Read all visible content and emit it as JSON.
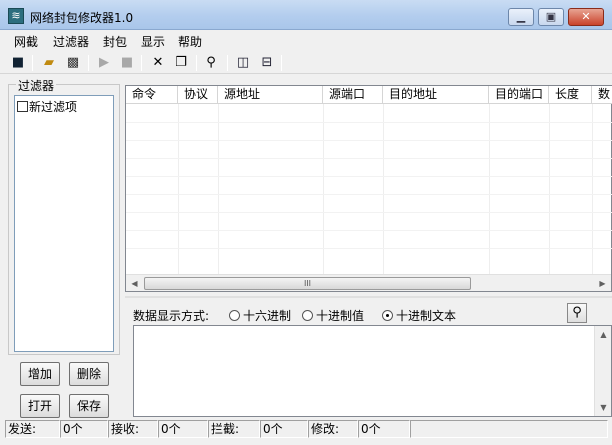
{
  "window": {
    "title": "网络封包修改器1.0",
    "icon": "app-logo-icon",
    "controls": [
      "minimize-icon",
      "maximize-icon",
      "close-icon"
    ]
  },
  "menu": [
    "网截",
    "过滤器",
    "封包",
    "显示",
    "帮助"
  ],
  "toolbar": [
    "save-icon",
    "open-folder-icon",
    "capture-icon",
    "play-icon",
    "stop-icon",
    "delete-icon",
    "copy-icon",
    "search-icon",
    "layout-vertical-icon",
    "layout-horizontal-icon"
  ],
  "filters": {
    "legend": "过滤器",
    "items": [
      {
        "label": "新过滤项",
        "checked": false
      }
    ],
    "buttons": {
      "add": "增加",
      "delete": "删除",
      "open": "打开",
      "save": "保存"
    }
  },
  "grid": {
    "columns": [
      "命令",
      "协议",
      "源地址",
      "源端口",
      "目的地址",
      "目的端口",
      "长度",
      "数"
    ],
    "scroll_grip": "III"
  },
  "display_mode": {
    "label": "数据显示方式:",
    "options": [
      {
        "label": "十六进制",
        "selected": false
      },
      {
        "label": "十进制值",
        "selected": false
      },
      {
        "label": "十进制文本",
        "selected": true
      }
    ]
  },
  "status": {
    "sent_label": "发送:",
    "sent": "0个",
    "received_label": "接收:",
    "received": "0个",
    "blocked_label": "拦截:",
    "blocked": "0个",
    "modified_label": "修改:",
    "modified": "0个"
  }
}
